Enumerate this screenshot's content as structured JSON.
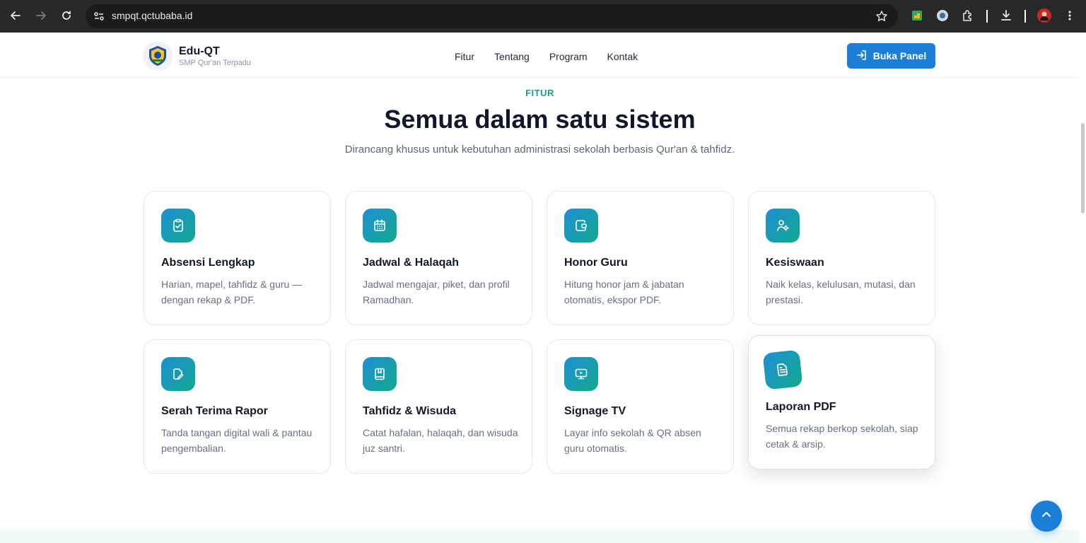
{
  "browser": {
    "url": "smpqt.qctubaba.id",
    "icons": [
      "back-icon",
      "forward-icon",
      "reload-icon",
      "site-settings-icon",
      "bookmark-star-icon",
      "extension-sheets-icon",
      "extension-circle-icon",
      "extensions-puzzle-icon",
      "download-icon",
      "profile-avatar-icon",
      "more-menu-icon"
    ]
  },
  "header": {
    "brand_name": "Edu-QT",
    "brand_tag": "SMP Qur'an Terpadu",
    "nav": [
      {
        "label": "Fitur"
      },
      {
        "label": "Tentang"
      },
      {
        "label": "Program"
      },
      {
        "label": "Kontak"
      }
    ],
    "cta_label": "Buka Panel"
  },
  "section": {
    "eyebrow": "FITUR",
    "headline": "Semua dalam satu sistem",
    "subline": "Dirancang khusus untuk kebutuhan administrasi sekolah berbasis Qur'an & tahfidz."
  },
  "features": [
    {
      "title": "Absensi Lengkap",
      "desc": "Harian, mapel, tahfidz & guru — dengan rekap & PDF.",
      "icon": "clipboard-check-icon"
    },
    {
      "title": "Jadwal & Halaqah",
      "desc": "Jadwal mengajar, piket, dan profil Ramadhan.",
      "icon": "calendar-icon"
    },
    {
      "title": "Honor Guru",
      "desc": "Hitung honor jam & jabatan otomatis, ekspor PDF.",
      "icon": "wallet-icon"
    },
    {
      "title": "Kesiswaan",
      "desc": "Naik kelas, kelulusan, mutasi, dan prestasi.",
      "icon": "user-cog-icon"
    },
    {
      "title": "Serah Terima Rapor",
      "desc": "Tanda tangan digital wali & pantau pengembalian.",
      "icon": "file-signature-icon"
    },
    {
      "title": "Tahfidz & Wisuda",
      "desc": "Catat hafalan, halaqah, dan wisuda juz santri.",
      "icon": "book-icon"
    },
    {
      "title": "Signage TV",
      "desc": "Layar info sekolah & QR absen guru otomatis.",
      "icon": "tv-play-icon"
    },
    {
      "title": "Laporan PDF",
      "desc": "Semua rekap berkop sekolah, siap cetak & arsip.",
      "icon": "document-icon"
    }
  ],
  "colors": {
    "primary": "#1b7fd8",
    "accent_green": "#16a085",
    "icon_gradient_start": "#1f8fd6",
    "icon_gradient_end": "#12a98d",
    "heading": "#0f172a"
  }
}
